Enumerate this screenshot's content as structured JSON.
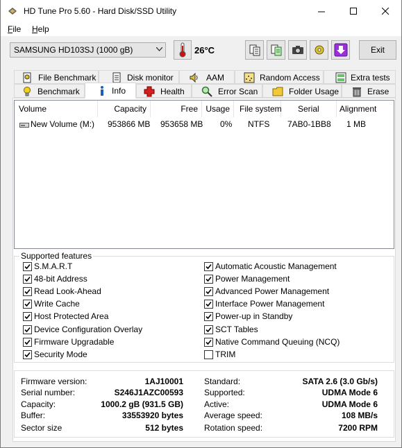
{
  "window": {
    "title": "HD Tune Pro 5.60 - Hard Disk/SSD Utility"
  },
  "menu": {
    "file_label": "File",
    "help_label": "Help"
  },
  "toolbar": {
    "drive_selected": "SAMSUNG HD103SJ (1000 gB)",
    "temperature": "26°C",
    "exit_label": "Exit"
  },
  "tabs_row1": [
    {
      "label": "File Benchmark",
      "icon": "file-benchmark-icon"
    },
    {
      "label": "Disk monitor",
      "icon": "disk-monitor-icon"
    },
    {
      "label": "AAM",
      "icon": "speaker-icon"
    },
    {
      "label": "Random Access",
      "icon": "random-access-icon"
    },
    {
      "label": "Extra tests",
      "icon": "extra-tests-icon"
    }
  ],
  "tabs_row2": [
    {
      "label": "Benchmark",
      "icon": "lightbulb-icon"
    },
    {
      "label": "Info",
      "icon": "info-icon"
    },
    {
      "label": "Health",
      "icon": "health-cross-icon"
    },
    {
      "label": "Error Scan",
      "icon": "magnifier-icon"
    },
    {
      "label": "Folder Usage",
      "icon": "folder-icon"
    },
    {
      "label": "Erase",
      "icon": "trash-icon"
    }
  ],
  "volumes": {
    "headers": [
      "Volume",
      "Capacity",
      "Free",
      "Usage",
      "File system",
      "Serial",
      "Alignment"
    ],
    "rows": [
      {
        "volume": "New Volume (M:)",
        "capacity": "953866 MB",
        "free": "953658 MB",
        "usage": "0%",
        "filesystem": "NTFS",
        "serial": "7AB0-1BB8",
        "alignment": "1 MB"
      }
    ]
  },
  "features": {
    "title": "Supported features",
    "left": [
      {
        "label": "S.M.A.R.T",
        "checked": true
      },
      {
        "label": "48-bit Address",
        "checked": true
      },
      {
        "label": "Read Look-Ahead",
        "checked": true
      },
      {
        "label": "Write Cache",
        "checked": true
      },
      {
        "label": "Host Protected Area",
        "checked": true
      },
      {
        "label": "Device Configuration Overlay",
        "checked": true
      },
      {
        "label": "Firmware Upgradable",
        "checked": true
      },
      {
        "label": "Security Mode",
        "checked": true
      }
    ],
    "right": [
      {
        "label": "Automatic Acoustic Management",
        "checked": true
      },
      {
        "label": "Power Management",
        "checked": true
      },
      {
        "label": "Advanced Power Management",
        "checked": true
      },
      {
        "label": "Interface Power Management",
        "checked": true
      },
      {
        "label": "Power-up in Standby",
        "checked": true
      },
      {
        "label": "SCT Tables",
        "checked": true
      },
      {
        "label": "Native Command Queuing (NCQ)",
        "checked": true
      },
      {
        "label": "TRIM",
        "checked": false
      }
    ]
  },
  "details": {
    "left": [
      {
        "label": "Firmware version:",
        "value": "1AJ10001"
      },
      {
        "label": "Serial number:",
        "value": "S246J1AZC00593"
      },
      {
        "label": "Capacity:",
        "value": "1000.2 gB (931.5 GB)"
      },
      {
        "label": "Buffer:",
        "value": "33553920 bytes"
      },
      {
        "label": "Sector size",
        "value": "512 bytes"
      }
    ],
    "right": [
      {
        "label": "Standard:",
        "value": "SATA 2.6 (3.0 Gb/s)"
      },
      {
        "label": "Supported:",
        "value": "UDMA Mode 6"
      },
      {
        "label": "Active:",
        "value": "UDMA Mode 6"
      },
      {
        "label": "Average speed:",
        "value": "108 MB/s"
      },
      {
        "label": "Rotation speed:",
        "value": "7200 RPM"
      }
    ]
  },
  "colors": {
    "accent_check": "#000000",
    "health_red": "#d32020",
    "info_blue": "#1c5fb8",
    "download_purple": "#8a2be2"
  }
}
